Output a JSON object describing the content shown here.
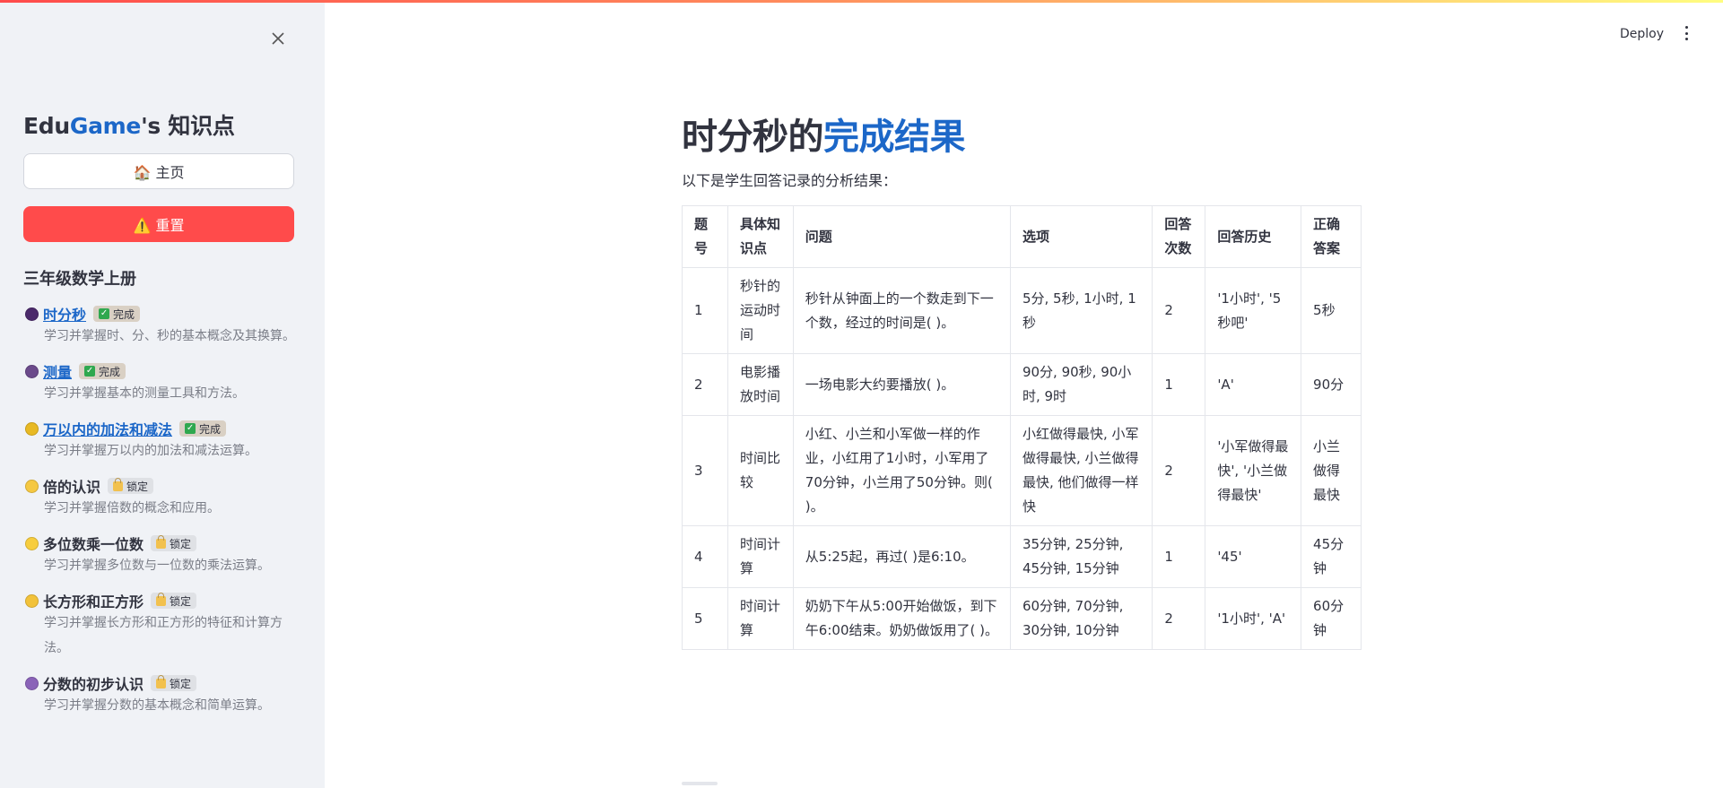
{
  "header": {
    "deploy_label": "Deploy"
  },
  "sidebar": {
    "title_prefix": "Edu",
    "title_brand": "Game",
    "title_suffix": "'s 知识点",
    "home_label": "🏠 主页",
    "reset_label": "⚠️ 重置",
    "section_title": "三年级数学上册",
    "items": [
      {
        "name": "时分秒",
        "status": "完成",
        "desc": "学习并掌握时、分、秒的基本概念及其换算。",
        "moon_color": "#4b2a6b",
        "is_link": true
      },
      {
        "name": "测量",
        "status": "完成",
        "desc": "学习并掌握基本的测量工具和方法。",
        "moon_color": "#6b4a8b",
        "is_link": true
      },
      {
        "name": "万以内的加法和减法",
        "status": "完成",
        "desc": "学习并掌握万以内的加法和减法运算。",
        "moon_color": "#e8b923",
        "is_link": true
      },
      {
        "name": "倍的认识",
        "status": "锁定",
        "desc": "学习并掌握倍数的概念和应用。",
        "moon_color": "#f5c842",
        "is_link": false
      },
      {
        "name": "多位数乘一位数",
        "status": "锁定",
        "desc": "学习并掌握多位数与一位数的乘法运算。",
        "moon_color": "#f7cd3e",
        "is_link": false
      },
      {
        "name": "长方形和正方形",
        "status": "锁定",
        "desc": "学习并掌握长方形和正方形的特征和计算方法。",
        "moon_color": "#f2c23a",
        "is_link": false
      },
      {
        "name": "分数的初步认识",
        "status": "锁定",
        "desc": "学习并掌握分数的基本概念和简单运算。",
        "moon_color": "#8a63b8",
        "is_link": false
      }
    ]
  },
  "main": {
    "title_part1": "时分秒的",
    "title_part2": "完成结果",
    "intro": "以下是学生回答记录的分析结果：",
    "table": {
      "headers": [
        "题号",
        "具体知识点",
        "问题",
        "选项",
        "回答次数",
        "回答历史",
        "正确答案"
      ],
      "rows": [
        [
          "1",
          "秒针的运动时间",
          "秒针从钟面上的一个数走到下一个数，经过的时间是( )。",
          "5分, 5秒, 1小时, 1秒",
          "2",
          "'1小时', '5秒吧'",
          "5秒"
        ],
        [
          "2",
          "电影播放时间",
          "一场电影大约要播放( )。",
          "90分, 90秒, 90小时, 9时",
          "1",
          "'A'",
          "90分"
        ],
        [
          "3",
          "时间比较",
          "小红、小兰和小军做一样的作业，小红用了1小时，小军用了70分钟，小兰用了50分钟。则( )。",
          "小红做得最快, 小军做得最快, 小兰做得最快, 他们做得一样快",
          "2",
          "'小军做得最快', '小兰做得最快'",
          "小兰做得最快"
        ],
        [
          "4",
          "时间计算",
          "从5:25起，再过( )是6:10。",
          "35分钟, 25分钟, 45分钟, 15分钟",
          "1",
          "'45'",
          "45分钟"
        ],
        [
          "5",
          "时间计算",
          "奶奶下午从5:00开始做饭，到下午6:00结束。奶奶做饭用了( )。",
          "60分钟, 70分钟, 30分钟, 10分钟",
          "2",
          "'1小时', 'A'",
          "60分钟"
        ]
      ]
    }
  }
}
